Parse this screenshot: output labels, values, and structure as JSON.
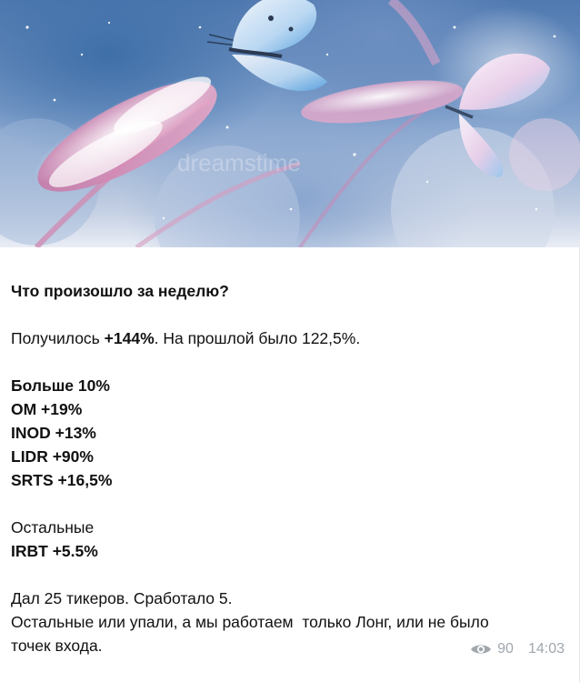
{
  "post": {
    "title": "Что произошло за неделю?",
    "result_prefix": "Получилось ",
    "result_value": "+144%",
    "result_suffix": ". На прошлой было 122,5%.",
    "group1_heading": "Больше 10%",
    "group1_items": [
      "OM +19%",
      "INOD +13%",
      "LIDR +90%",
      "SRTS +16,5%"
    ],
    "group2_heading": "Остальные",
    "group2_items": [
      "IRBT +5.5%"
    ],
    "note_line1": "Дал 25 тикеров. Сработало 5.",
    "note_line2": "Остальные или упали, а мы работаем  только Лонг, или не было",
    "note_line3": "точек входа."
  },
  "meta": {
    "views_icon": "eye-icon",
    "views": "90",
    "time": "14:03"
  },
  "image": {
    "watermark": "dreamstime",
    "colors": {
      "sky": "#6a8fc3",
      "frost": "#ffffff",
      "grass": "#d98fb4",
      "wing_blue": "#7fb8e8"
    }
  }
}
